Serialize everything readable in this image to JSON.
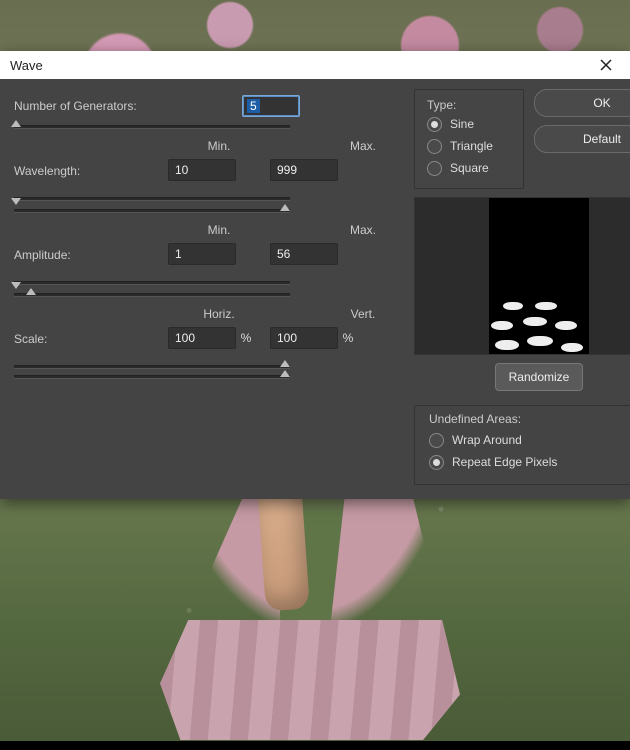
{
  "dialog": {
    "title": "Wave",
    "generators": {
      "label": "Number of Generators:",
      "value": "5"
    },
    "wavelength": {
      "label": "Wavelength:",
      "minLabel": "Min.",
      "maxLabel": "Max.",
      "min": "10",
      "max": "999"
    },
    "amplitude": {
      "label": "Amplitude:",
      "minLabel": "Min.",
      "maxLabel": "Max.",
      "min": "1",
      "max": "56"
    },
    "scale": {
      "label": "Scale:",
      "horizLabel": "Horiz.",
      "vertLabel": "Vert.",
      "horiz": "100",
      "vert": "100",
      "pct": "%"
    },
    "type": {
      "label": "Type:",
      "options": [
        "Sine",
        "Triangle",
        "Square"
      ],
      "selected": "Sine"
    },
    "buttons": {
      "ok": "OK",
      "default": "Default",
      "randomize": "Randomize"
    },
    "undefined": {
      "label": "Undefined Areas:",
      "options": [
        "Wrap Around",
        "Repeat Edge Pixels"
      ],
      "selected": "Repeat Edge Pixels"
    }
  }
}
